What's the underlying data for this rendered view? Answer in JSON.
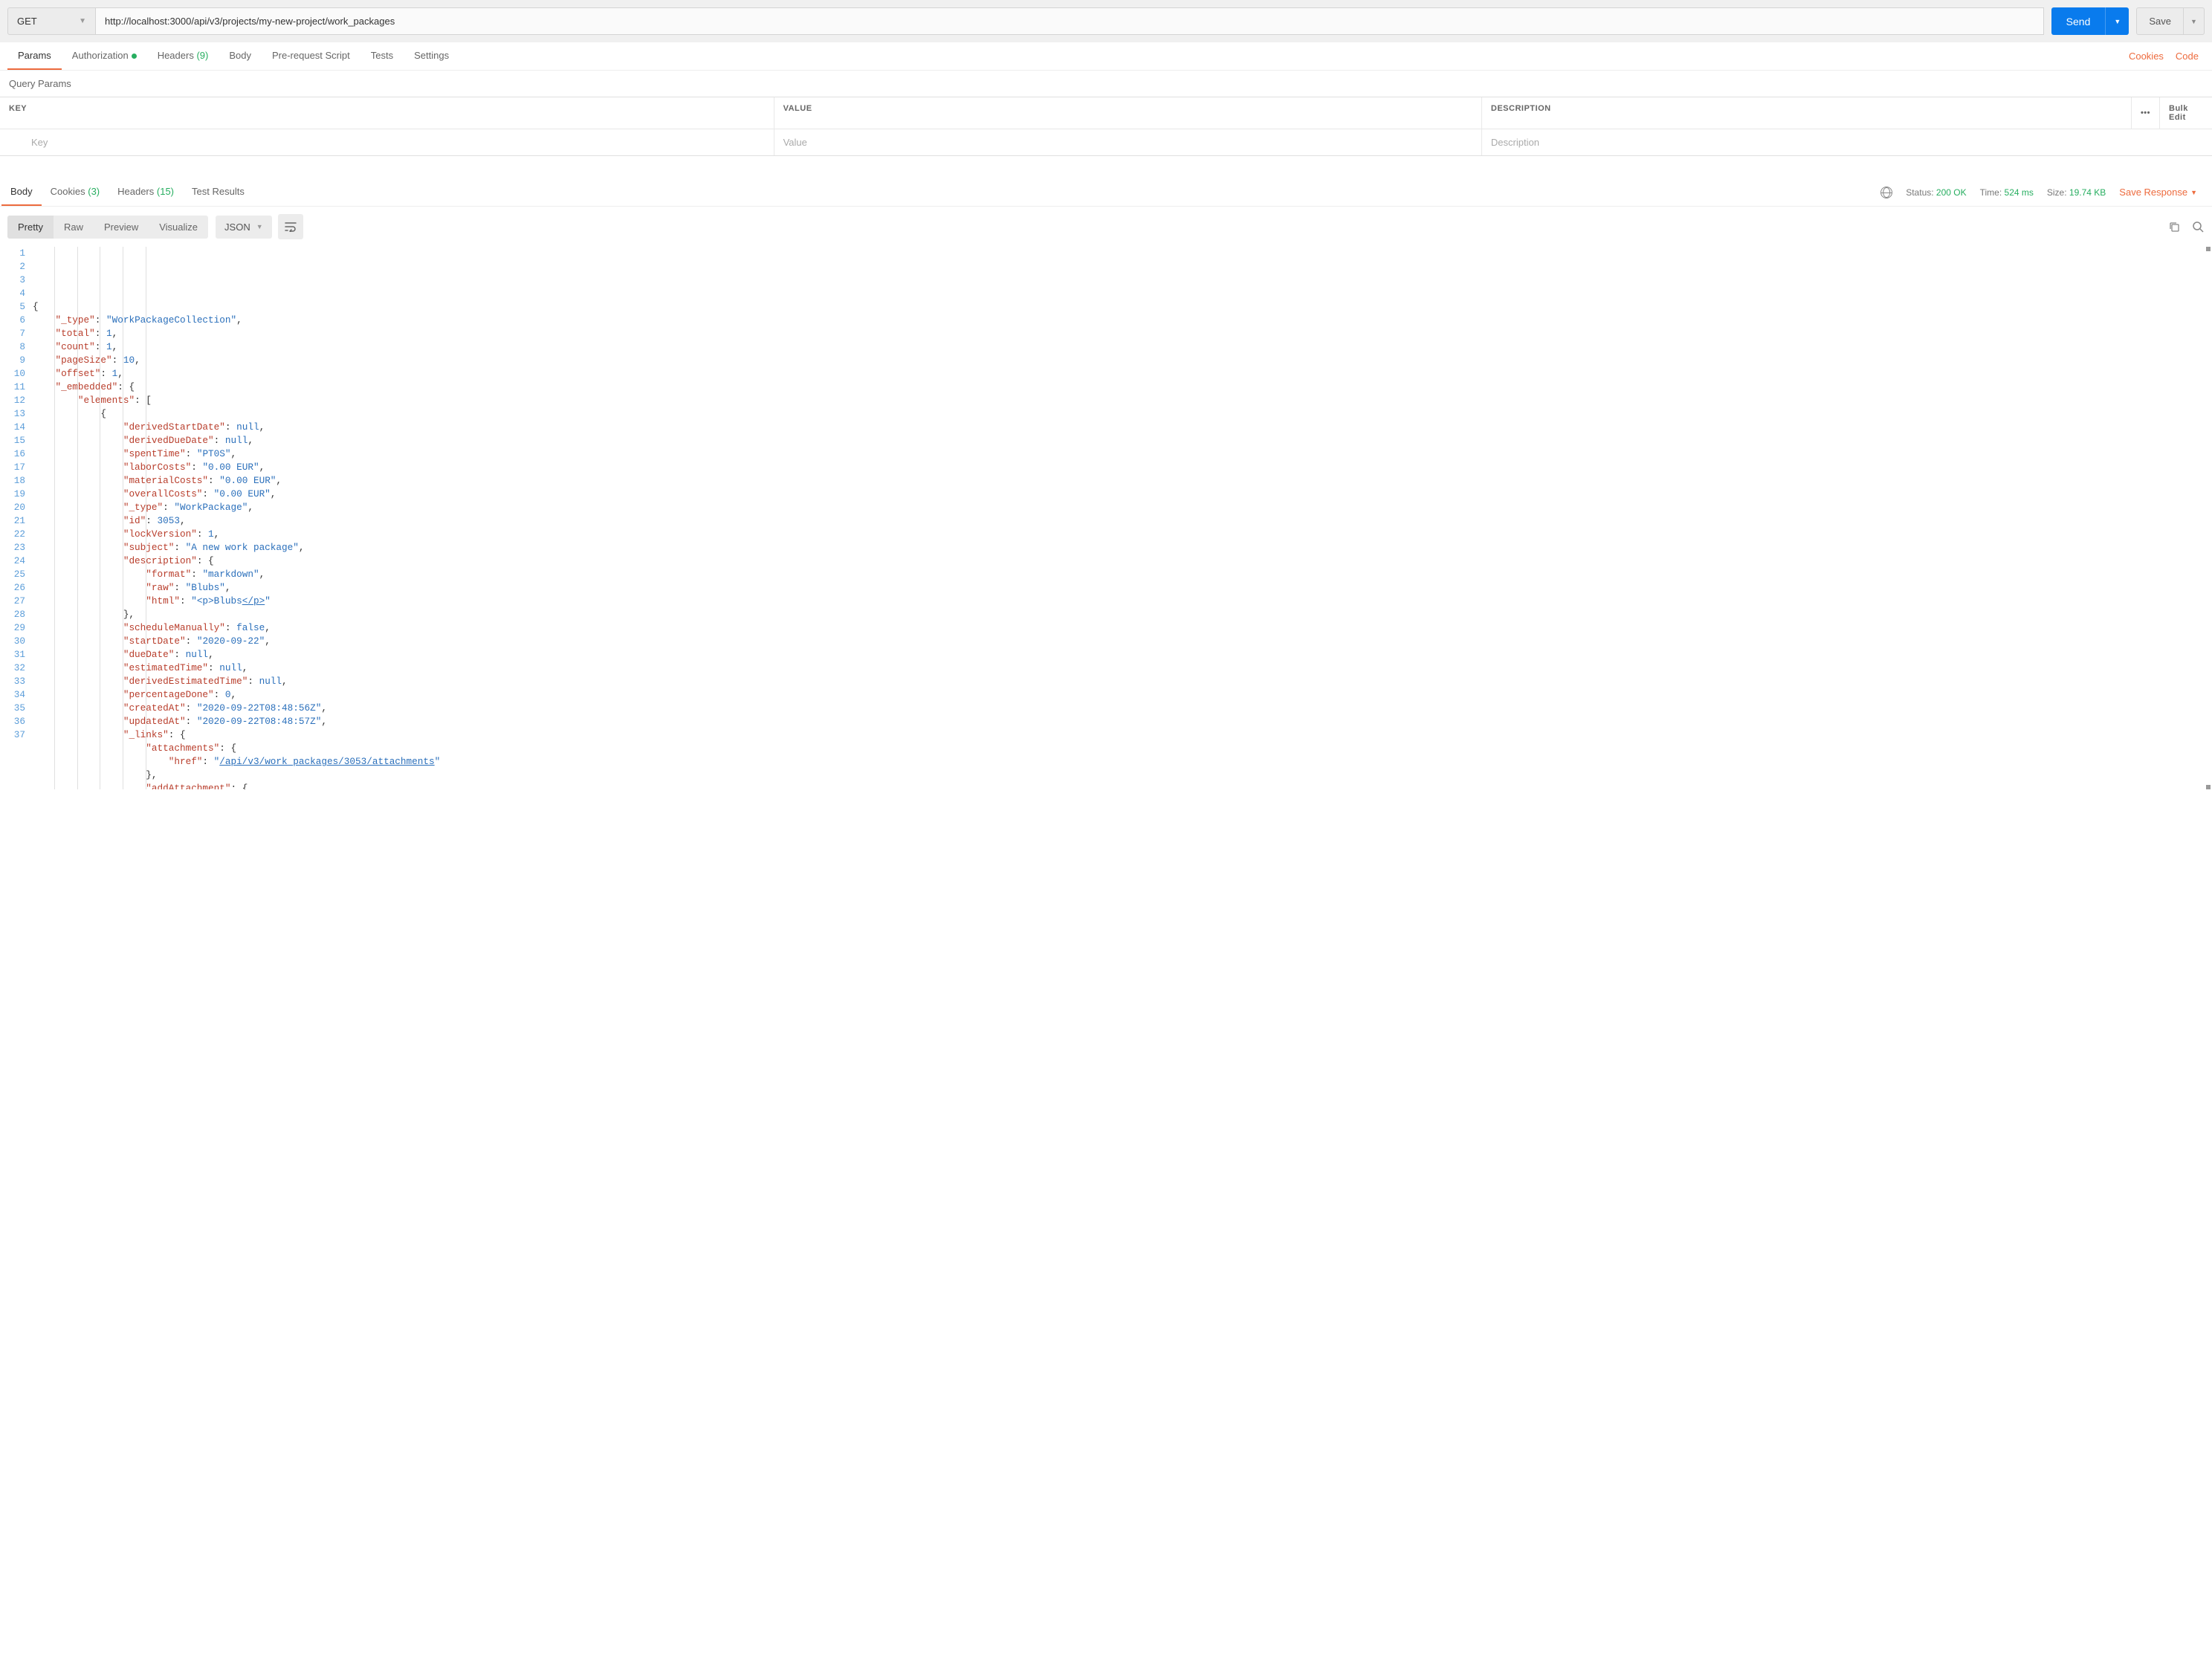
{
  "request": {
    "method": "GET",
    "url": "http://localhost:3000/api/v3/projects/my-new-project/work_packages",
    "send_label": "Send",
    "save_label": "Save"
  },
  "req_tabs": {
    "params": "Params",
    "auth": "Authorization",
    "headers": "Headers",
    "headers_count": "(9)",
    "body": "Body",
    "prerequest": "Pre-request Script",
    "tests": "Tests",
    "settings": "Settings",
    "cookies_link": "Cookies",
    "code_link": "Code"
  },
  "query_params": {
    "title": "Query Params",
    "head_key": "KEY",
    "head_value": "VALUE",
    "head_desc": "DESCRIPTION",
    "bulk_edit": "Bulk Edit",
    "ph_key": "Key",
    "ph_value": "Value",
    "ph_desc": "Description"
  },
  "resp_tabs": {
    "body": "Body",
    "cookies": "Cookies",
    "cookies_count": "(3)",
    "headers": "Headers",
    "headers_count": "(15)",
    "tests": "Test Results"
  },
  "resp_meta": {
    "status_label": "Status:",
    "status_value": "200 OK",
    "time_label": "Time:",
    "time_value": "524 ms",
    "size_label": "Size:",
    "size_value": "19.74 KB",
    "save_response": "Save Response"
  },
  "resp_toolbar": {
    "pretty": "Pretty",
    "raw": "Raw",
    "preview": "Preview",
    "visualize": "Visualize",
    "format": "JSON"
  },
  "code_lines": [
    {
      "n": 1,
      "indent": 0,
      "t": [
        {
          "p": "{"
        }
      ]
    },
    {
      "n": 2,
      "indent": 1,
      "t": [
        {
          "s": "\"_type\""
        },
        {
          "p": ": "
        },
        {
          "v": "\"WorkPackageCollection\""
        },
        {
          "p": ","
        }
      ]
    },
    {
      "n": 3,
      "indent": 1,
      "t": [
        {
          "s": "\"total\""
        },
        {
          "p": ": "
        },
        {
          "n_": "1"
        },
        {
          "p": ","
        }
      ]
    },
    {
      "n": 4,
      "indent": 1,
      "t": [
        {
          "s": "\"count\""
        },
        {
          "p": ": "
        },
        {
          "n_": "1"
        },
        {
          "p": ","
        }
      ]
    },
    {
      "n": 5,
      "indent": 1,
      "t": [
        {
          "s": "\"pageSize\""
        },
        {
          "p": ": "
        },
        {
          "n_": "10"
        },
        {
          "p": ","
        }
      ]
    },
    {
      "n": 6,
      "indent": 1,
      "t": [
        {
          "s": "\"offset\""
        },
        {
          "p": ": "
        },
        {
          "n_": "1"
        },
        {
          "p": ","
        }
      ]
    },
    {
      "n": 7,
      "indent": 1,
      "t": [
        {
          "s": "\"_embedded\""
        },
        {
          "p": ": {"
        }
      ]
    },
    {
      "n": 8,
      "indent": 2,
      "t": [
        {
          "s": "\"elements\""
        },
        {
          "p": ": ["
        }
      ]
    },
    {
      "n": 9,
      "indent": 3,
      "t": [
        {
          "p": "{"
        }
      ]
    },
    {
      "n": 10,
      "indent": 4,
      "t": [
        {
          "s": "\"derivedStartDate\""
        },
        {
          "p": ": "
        },
        {
          "k": "null"
        },
        {
          "p": ","
        }
      ]
    },
    {
      "n": 11,
      "indent": 4,
      "t": [
        {
          "s": "\"derivedDueDate\""
        },
        {
          "p": ": "
        },
        {
          "k": "null"
        },
        {
          "p": ","
        }
      ]
    },
    {
      "n": 12,
      "indent": 4,
      "t": [
        {
          "s": "\"spentTime\""
        },
        {
          "p": ": "
        },
        {
          "v": "\"PT0S\""
        },
        {
          "p": ","
        }
      ]
    },
    {
      "n": 13,
      "indent": 4,
      "t": [
        {
          "s": "\"laborCosts\""
        },
        {
          "p": ": "
        },
        {
          "v": "\"0.00 EUR\""
        },
        {
          "p": ","
        }
      ]
    },
    {
      "n": 14,
      "indent": 4,
      "t": [
        {
          "s": "\"materialCosts\""
        },
        {
          "p": ": "
        },
        {
          "v": "\"0.00 EUR\""
        },
        {
          "p": ","
        }
      ]
    },
    {
      "n": 15,
      "indent": 4,
      "t": [
        {
          "s": "\"overallCosts\""
        },
        {
          "p": ": "
        },
        {
          "v": "\"0.00 EUR\""
        },
        {
          "p": ","
        }
      ]
    },
    {
      "n": 16,
      "indent": 4,
      "t": [
        {
          "s": "\"_type\""
        },
        {
          "p": ": "
        },
        {
          "v": "\"WorkPackage\""
        },
        {
          "p": ","
        }
      ]
    },
    {
      "n": 17,
      "indent": 4,
      "t": [
        {
          "s": "\"id\""
        },
        {
          "p": ": "
        },
        {
          "n_": "3053"
        },
        {
          "p": ","
        }
      ]
    },
    {
      "n": 18,
      "indent": 4,
      "t": [
        {
          "s": "\"lockVersion\""
        },
        {
          "p": ": "
        },
        {
          "n_": "1"
        },
        {
          "p": ","
        }
      ]
    },
    {
      "n": 19,
      "indent": 4,
      "t": [
        {
          "s": "\"subject\""
        },
        {
          "p": ": "
        },
        {
          "v": "\"A new work package\""
        },
        {
          "p": ","
        }
      ]
    },
    {
      "n": 20,
      "indent": 4,
      "t": [
        {
          "s": "\"description\""
        },
        {
          "p": ": {"
        }
      ]
    },
    {
      "n": 21,
      "indent": 5,
      "t": [
        {
          "s": "\"format\""
        },
        {
          "p": ": "
        },
        {
          "v": "\"markdown\""
        },
        {
          "p": ","
        }
      ]
    },
    {
      "n": 22,
      "indent": 5,
      "t": [
        {
          "s": "\"raw\""
        },
        {
          "p": ": "
        },
        {
          "v": "\"Blubs\""
        },
        {
          "p": ","
        }
      ]
    },
    {
      "n": 23,
      "indent": 5,
      "t": [
        {
          "s": "\"html\""
        },
        {
          "p": ": "
        },
        {
          "v": "\"<p>Blubs"
        },
        {
          "l": "</p>"
        },
        {
          "v": "\""
        }
      ]
    },
    {
      "n": 24,
      "indent": 4,
      "t": [
        {
          "p": "},"
        }
      ]
    },
    {
      "n": 25,
      "indent": 4,
      "t": [
        {
          "s": "\"scheduleManually\""
        },
        {
          "p": ": "
        },
        {
          "k": "false"
        },
        {
          "p": ","
        }
      ]
    },
    {
      "n": 26,
      "indent": 4,
      "t": [
        {
          "s": "\"startDate\""
        },
        {
          "p": ": "
        },
        {
          "v": "\"2020-09-22\""
        },
        {
          "p": ","
        }
      ]
    },
    {
      "n": 27,
      "indent": 4,
      "t": [
        {
          "s": "\"dueDate\""
        },
        {
          "p": ": "
        },
        {
          "k": "null"
        },
        {
          "p": ","
        }
      ]
    },
    {
      "n": 28,
      "indent": 4,
      "t": [
        {
          "s": "\"estimatedTime\""
        },
        {
          "p": ": "
        },
        {
          "k": "null"
        },
        {
          "p": ","
        }
      ]
    },
    {
      "n": 29,
      "indent": 4,
      "t": [
        {
          "s": "\"derivedEstimatedTime\""
        },
        {
          "p": ": "
        },
        {
          "k": "null"
        },
        {
          "p": ","
        }
      ]
    },
    {
      "n": 30,
      "indent": 4,
      "t": [
        {
          "s": "\"percentageDone\""
        },
        {
          "p": ": "
        },
        {
          "n_": "0"
        },
        {
          "p": ","
        }
      ]
    },
    {
      "n": 31,
      "indent": 4,
      "t": [
        {
          "s": "\"createdAt\""
        },
        {
          "p": ": "
        },
        {
          "v": "\"2020-09-22T08:48:56Z\""
        },
        {
          "p": ","
        }
      ]
    },
    {
      "n": 32,
      "indent": 4,
      "t": [
        {
          "s": "\"updatedAt\""
        },
        {
          "p": ": "
        },
        {
          "v": "\"2020-09-22T08:48:57Z\""
        },
        {
          "p": ","
        }
      ]
    },
    {
      "n": 33,
      "indent": 4,
      "t": [
        {
          "s": "\"_links\""
        },
        {
          "p": ": {"
        }
      ]
    },
    {
      "n": 34,
      "indent": 5,
      "t": [
        {
          "s": "\"attachments\""
        },
        {
          "p": ": {"
        }
      ]
    },
    {
      "n": 35,
      "indent": 6,
      "t": [
        {
          "s": "\"href\""
        },
        {
          "p": ": "
        },
        {
          "v": "\""
        },
        {
          "l": "/api/v3/work_packages/3053/attachments"
        },
        {
          "v": "\""
        }
      ]
    },
    {
      "n": 36,
      "indent": 5,
      "t": [
        {
          "p": "},"
        }
      ]
    },
    {
      "n": 37,
      "indent": 5,
      "t": [
        {
          "s": "\"addAttachment\""
        },
        {
          "p": ": {"
        }
      ],
      "cut": true
    }
  ]
}
